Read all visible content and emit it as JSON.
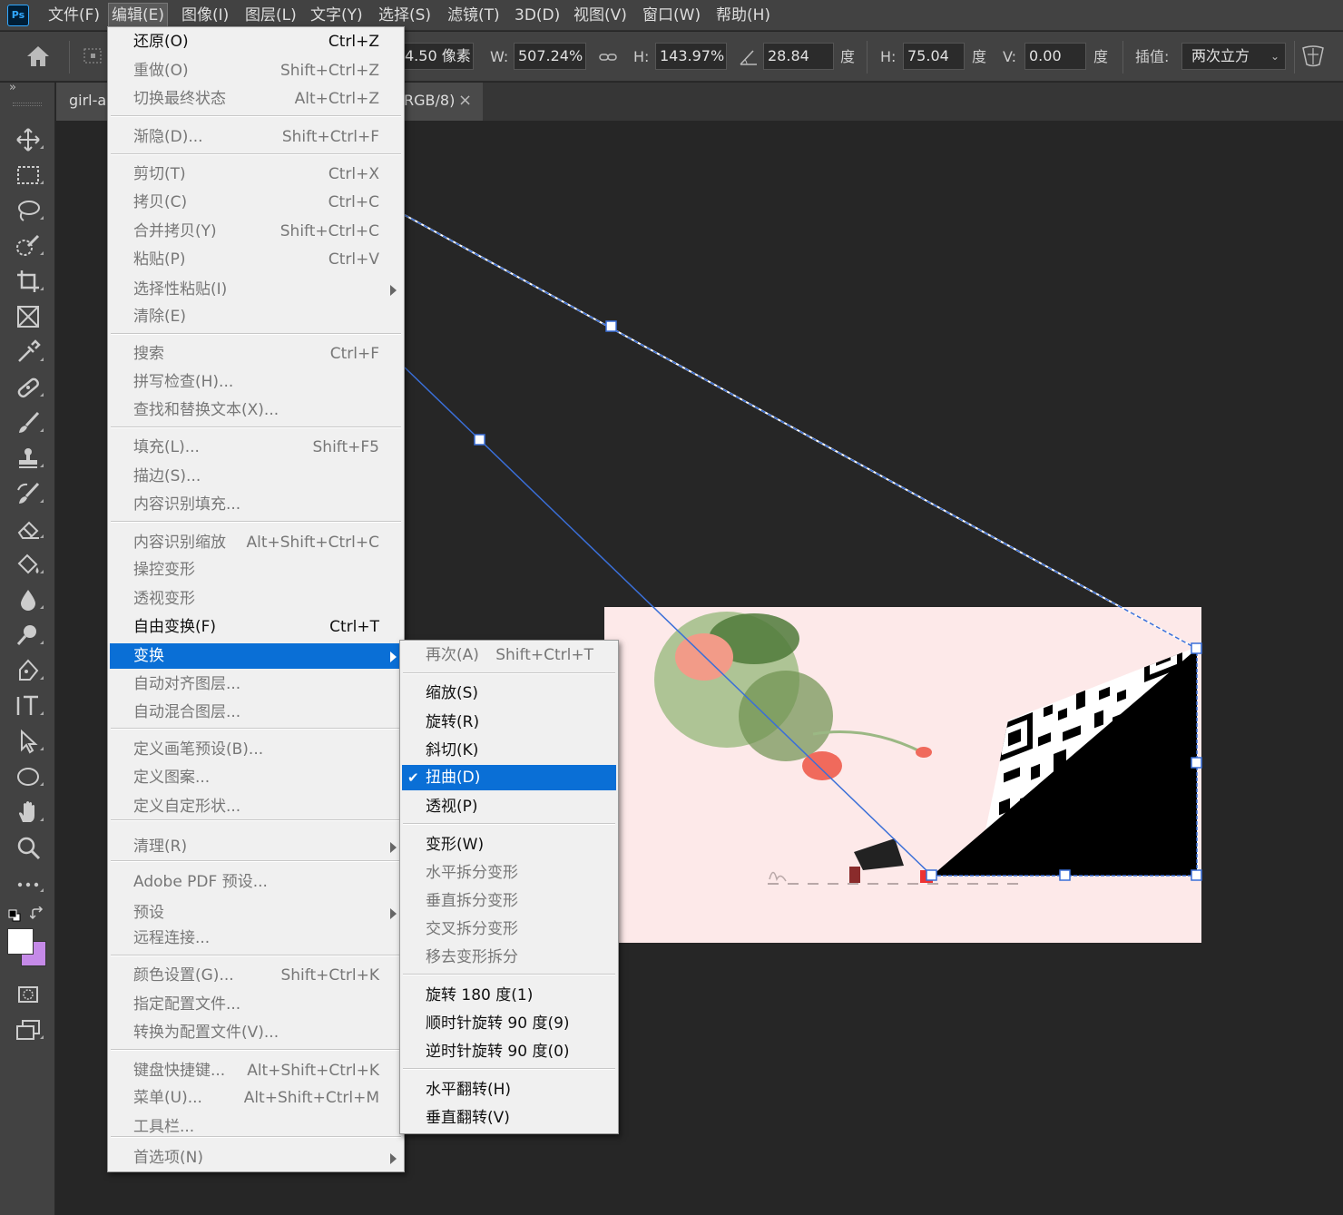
{
  "app": {
    "logo": "Ps"
  },
  "menubar": [
    "文件(F)",
    "编辑(E)",
    "图像(I)",
    "图层(L)",
    "文字(Y)",
    "选择(S)",
    "滤镜(T)",
    "3D(D)",
    "视图(V)",
    "窗口(W)",
    "帮助(H)"
  ],
  "options": {
    "x_value": "4.50 像素",
    "w_label": "W:",
    "w_value": "507.24%",
    "h_label": "H:",
    "h_value": "143.97%",
    "angle_value": "28.84",
    "deg1": "度",
    "hskew_label": "H:",
    "hskew_value": "75.04",
    "deg2": "度",
    "vskew_label": "V:",
    "vskew_value": "0.00",
    "deg3": "度",
    "interp_label": "插值:",
    "interp_value": "两次立方"
  },
  "tabs": {
    "collapse": "»",
    "tab1": "girl-a",
    "tab2": "RGB/8)",
    "close": "×"
  },
  "edit_menu": {
    "items": [
      {
        "label": "还原(O)",
        "shortcut": "Ctrl+Z",
        "enabled": true
      },
      {
        "label": "重做(O)",
        "shortcut": "Shift+Ctrl+Z"
      },
      {
        "label": "切换最终状态",
        "shortcut": "Alt+Ctrl+Z"
      },
      {
        "label": "渐隐(D)...",
        "shortcut": "Shift+Ctrl+F"
      },
      {
        "label": "剪切(T)",
        "shortcut": "Ctrl+X"
      },
      {
        "label": "拷贝(C)",
        "shortcut": "Ctrl+C"
      },
      {
        "label": "合并拷贝(Y)",
        "shortcut": "Shift+Ctrl+C"
      },
      {
        "label": "粘贴(P)",
        "shortcut": "Ctrl+V"
      },
      {
        "label": "选择性粘贴(I)",
        "shortcut": ""
      },
      {
        "label": "清除(E)",
        "shortcut": ""
      },
      {
        "label": "搜索",
        "shortcut": "Ctrl+F"
      },
      {
        "label": "拼写检查(H)...",
        "shortcut": ""
      },
      {
        "label": "查找和替换文本(X)...",
        "shortcut": ""
      },
      {
        "label": "填充(L)...",
        "shortcut": "Shift+F5"
      },
      {
        "label": "描边(S)...",
        "shortcut": ""
      },
      {
        "label": "内容识别填充...",
        "shortcut": ""
      },
      {
        "label": "内容识别缩放",
        "shortcut": "Alt+Shift+Ctrl+C"
      },
      {
        "label": "操控变形",
        "shortcut": ""
      },
      {
        "label": "透视变形",
        "shortcut": ""
      },
      {
        "label": "自由变换(F)",
        "shortcut": "Ctrl+T",
        "enabled": true
      },
      {
        "label": "变换",
        "shortcut": "",
        "highlight": true
      },
      {
        "label": "自动对齐图层...",
        "shortcut": ""
      },
      {
        "label": "自动混合图层...",
        "shortcut": ""
      },
      {
        "label": "定义画笔预设(B)...",
        "shortcut": ""
      },
      {
        "label": "定义图案...",
        "shortcut": ""
      },
      {
        "label": "定义自定形状...",
        "shortcut": ""
      },
      {
        "label": "清理(R)",
        "shortcut": ""
      },
      {
        "label": "Adobe PDF 预设...",
        "shortcut": ""
      },
      {
        "label": "预设",
        "shortcut": ""
      },
      {
        "label": "远程连接...",
        "shortcut": ""
      },
      {
        "label": "颜色设置(G)...",
        "shortcut": "Shift+Ctrl+K"
      },
      {
        "label": "指定配置文件...",
        "shortcut": ""
      },
      {
        "label": "转换为配置文件(V)...",
        "shortcut": ""
      },
      {
        "label": "键盘快捷键...",
        "shortcut": "Alt+Shift+Ctrl+K"
      },
      {
        "label": "菜单(U)...",
        "shortcut": "Alt+Shift+Ctrl+M"
      },
      {
        "label": "工具栏...",
        "shortcut": ""
      },
      {
        "label": "首选项(N)",
        "shortcut": ""
      }
    ]
  },
  "transform_menu": {
    "checkmark": "✔",
    "items": [
      {
        "label": "再次(A)",
        "shortcut": "Shift+Ctrl+T"
      },
      {
        "label": "缩放(S)",
        "enabled": true
      },
      {
        "label": "旋转(R)",
        "enabled": true
      },
      {
        "label": "斜切(K)",
        "enabled": true
      },
      {
        "label": "扭曲(D)",
        "highlight": true,
        "checked": true
      },
      {
        "label": "透视(P)",
        "enabled": true
      },
      {
        "label": "变形(W)",
        "enabled": true
      },
      {
        "label": "水平拆分变形"
      },
      {
        "label": "垂直拆分变形"
      },
      {
        "label": "交叉拆分变形"
      },
      {
        "label": "移去变形拆分"
      },
      {
        "label": "旋转 180 度(1)",
        "enabled": true
      },
      {
        "label": "顺时针旋转 90 度(9)",
        "enabled": true
      },
      {
        "label": "逆时针旋转 90 度(0)",
        "enabled": true
      },
      {
        "label": "水平翻转(H)",
        "enabled": true
      },
      {
        "label": "垂直翻转(V)",
        "enabled": true
      }
    ]
  },
  "colors": {
    "foreground": "#ffffff",
    "background": "#c58ae8",
    "highlight": "#0a6fd6",
    "artboard": "#fde9e9",
    "transform_line": "#3a6fd8"
  }
}
